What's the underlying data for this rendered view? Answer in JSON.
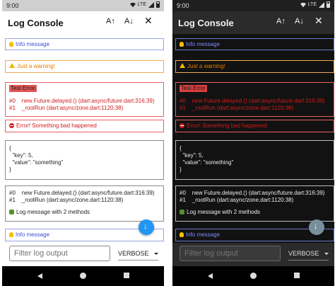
{
  "statusbar": {
    "time": "9:00",
    "network": "LTE"
  },
  "appbar": {
    "title": "Log Console",
    "increase_font": "A↑",
    "decrease_font": "A↓",
    "close": "✕"
  },
  "logs": {
    "info1": {
      "text": "Info message",
      "icon": "lightbulb-icon"
    },
    "warning": {
      "text": "Just a warning!",
      "icon": "warning-icon"
    },
    "error": {
      "title": "Test Error",
      "trace": "#0    new Future.delayed.() (dart:async/future.dart:316:39)\n#1    _rootRun (dart:async/zone.dart:1120:38)"
    },
    "error_msg": {
      "text": "Error! Something bad happened",
      "icon": "no-entry-icon"
    },
    "json": {
      "text": "{\n  \"key\": 5,\n  \"value\": \"something\"\n}"
    },
    "debug": {
      "trace": "#0    new Future.delayed.() (dart:async/future.dart:316:39)\n#1    _rootRun (dart:async/zone.dart:1120:38)",
      "text": "Log message with 2 methods",
      "icon": "bug-icon"
    },
    "info2": {
      "text": "Info message",
      "icon": "lightbulb-icon"
    }
  },
  "filter": {
    "placeholder": "Filter log output"
  },
  "level": {
    "selected": "VERBOSE"
  },
  "colors": {
    "info": "#3a4fd6",
    "warning": "#e07d00",
    "error": "#d11b1b",
    "fab_light": "#2196f3",
    "fab_dark": "#78909c"
  }
}
